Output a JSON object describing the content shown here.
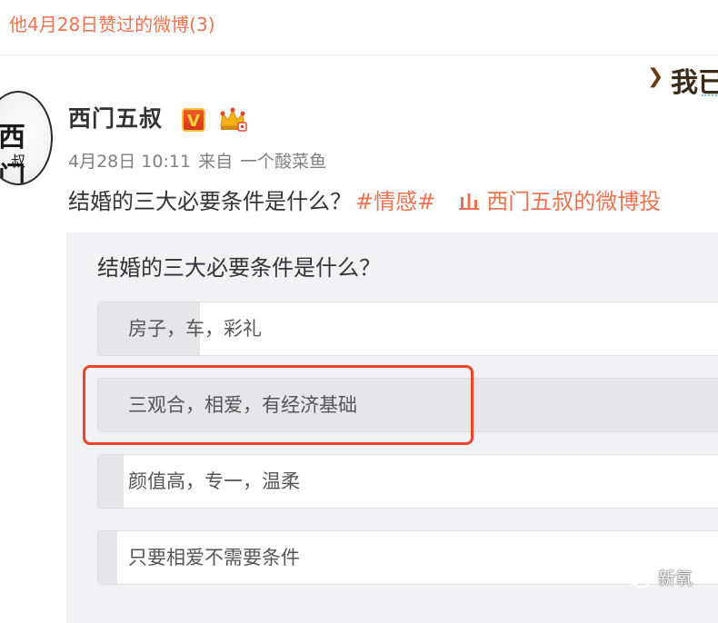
{
  "header": {
    "title": "他4月28日赞过的微博(3)"
  },
  "banner": {
    "text": "我已"
  },
  "post": {
    "username": "西门五叔",
    "verified_badge": "V",
    "meta": {
      "date": "4月28日 10:11",
      "source_prefix": "来自",
      "source": "一个酸菜鱼"
    },
    "text": "结婚的三大必要条件是什么？",
    "topic": "#情感#",
    "link_text": "西门五叔的微博投"
  },
  "vote": {
    "question": "结婚的三大必要条件是什么？",
    "options": [
      {
        "label": "房子，车，彩礼",
        "fill_fraction": 0.16
      },
      {
        "label": "三观合，相爱，有经济基础",
        "fill_fraction": 1.0
      },
      {
        "label": "颜值高，专一，温柔",
        "fill_fraction": 0.04
      },
      {
        "label": "只要相爱不需要条件",
        "fill_fraction": 0.03
      }
    ],
    "highlighted_option": 1
  },
  "watermark": {
    "text": "新氧"
  },
  "colors": {
    "accent": "#eb7350",
    "highlight": "#e8452c",
    "card_bg": "#f2f2f5"
  },
  "icons": [
    "v-badge-icon",
    "crown-icon",
    "poll-link-icon",
    "wechat-icon"
  ]
}
